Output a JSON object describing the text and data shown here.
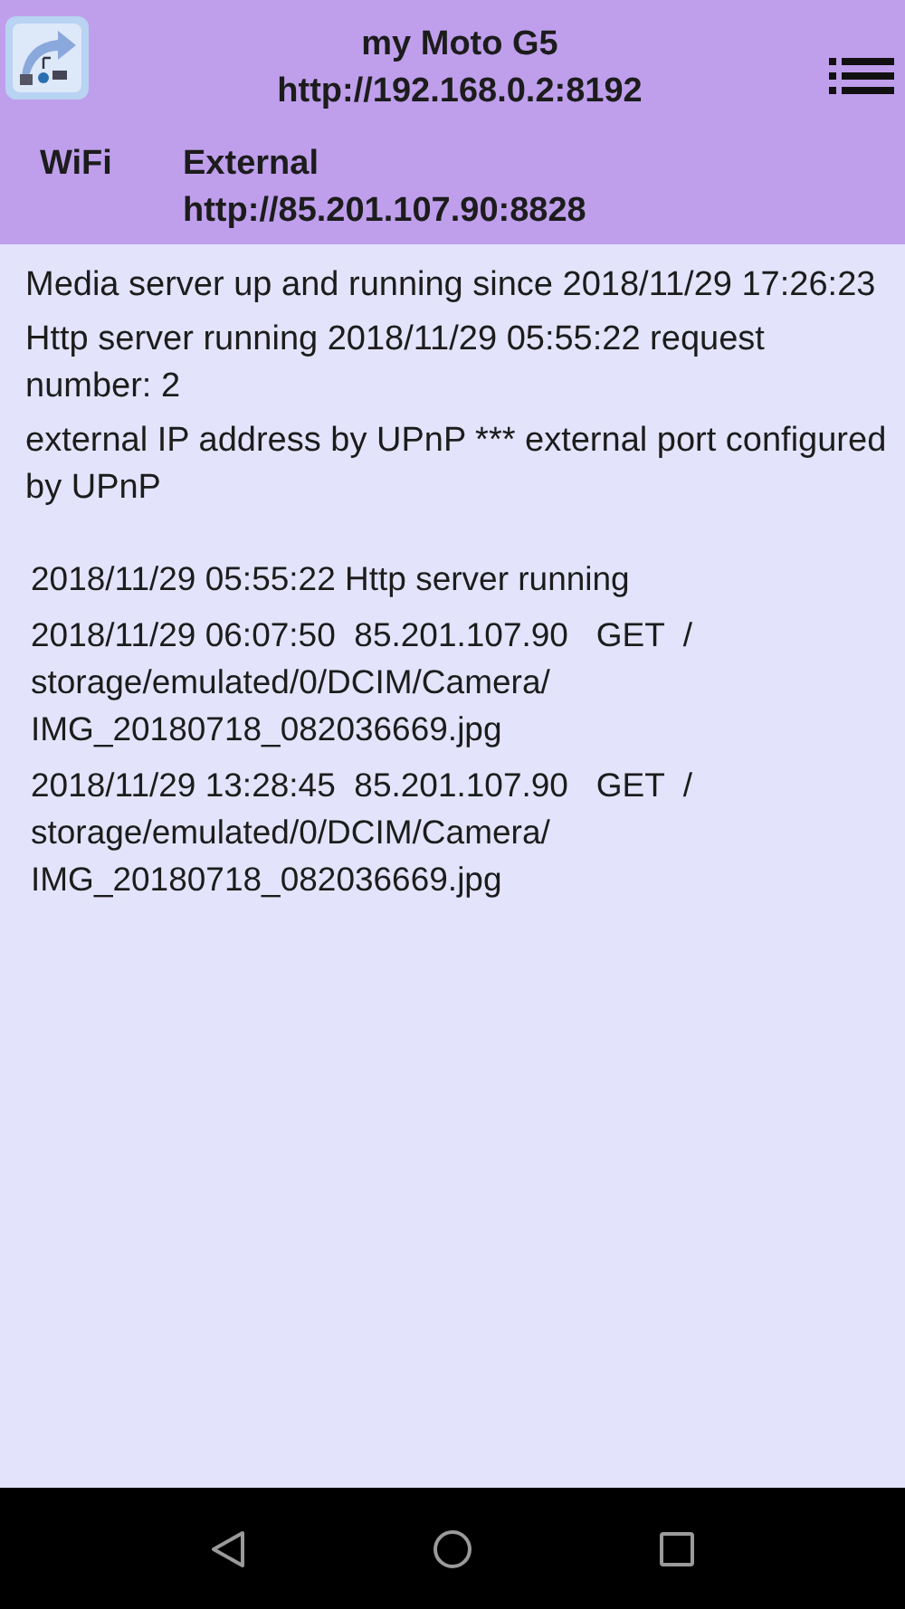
{
  "header": {
    "title": "my Moto G5",
    "local_address": "http://192.168.0.2:8192",
    "network": "WiFi",
    "external_label": "External",
    "external_address": "http://85.201.107.90:8828"
  },
  "status": [
    "Media server up and running since 2018/11/29 17:26:23",
    "Http server running 2018/11/29 05:55:22 request number: 2",
    "external IP address by UPnP *** external port configured by UPnP"
  ],
  "log": [
    "2018/11/29 05:55:22 Http server running",
    "2018/11/29 06:07:50  85.201.107.90   GET  /\nstorage/emulated/0/DCIM/Camera/\nIMG_20180718_082036669.jpg",
    "2018/11/29 13:28:45  85.201.107.90   GET  /\nstorage/emulated/0/DCIM/Camera/\nIMG_20180718_082036669.jpg"
  ]
}
